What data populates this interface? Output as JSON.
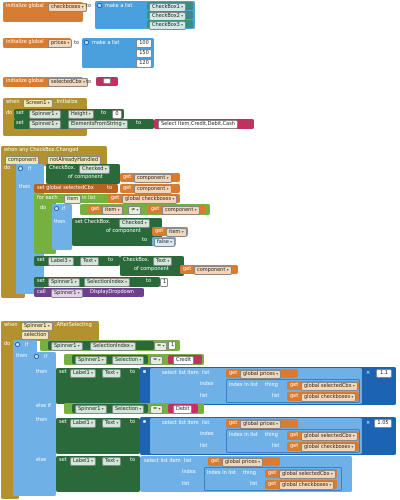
{
  "globals": {
    "checkboxes": {
      "kw": "initialize global",
      "name": "checkboxes",
      "to": "to",
      "make": "make a list",
      "items": [
        "CheckBox1",
        "CheckBox2",
        "CheckBox3"
      ]
    },
    "prices": {
      "kw": "initialize global",
      "name": "prices",
      "to": "to",
      "make": "make a list",
      "items": [
        "100",
        "150",
        "120"
      ]
    },
    "selected": {
      "kw": "initialize global",
      "name": "selectedCbx",
      "to": "to",
      "value": " "
    }
  },
  "init_block": {
    "when": "when",
    "component": "Screen1",
    "event": ".Initialize",
    "do": "do",
    "row1": {
      "set": "set",
      "comp": "Spinner1",
      "prop": "Height",
      "to": "to",
      "value": "0"
    },
    "row2": {
      "set": "set",
      "comp": "Spinner1",
      "prop": "ElementsFromString",
      "to": "to",
      "value": "Select Item,Credit,Debit,Cash"
    }
  },
  "changed_block": {
    "header": "when any CheckBox.Changed",
    "param1": "component",
    "param2": "notAlreadyHandled",
    "do": "do",
    "if": "if",
    "then": "then",
    "cb_label": "CheckBox.",
    "checked": "Checked",
    "of_component": "of component",
    "get": "get",
    "component": "component",
    "set_global": "set global selectedCbx",
    "to": "to",
    "for_each": "for each",
    "item": "item",
    "in_list": "in list",
    "global_checkboxes": "global checkboxes",
    "not_eq": "≠",
    "set_cb": "set CheckBox.",
    "false": "false",
    "set": "set",
    "label3": "Label3",
    "text": "Text",
    "cb_text": "CheckBox.",
    "text_prop": "Text",
    "spinner": "Spinner1",
    "sel_index": "SelectionIndex",
    "one": "1",
    "call": "call",
    "display": "DisplayDropdown"
  },
  "after_block": {
    "when": "when",
    "component": "Spinner1",
    "event": ".AfterSelecting",
    "param": "selection",
    "do": "do",
    "if": "if",
    "then": "then",
    "else_if": "else if",
    "else": "else",
    "spinner": "Spinner1",
    "sel_index": "SelectionIndex",
    "selection": "Selection",
    "eq": "=",
    "one": "1",
    "credit": "Credit",
    "debit": "Debit",
    "set": "set",
    "label1": "Label1",
    "text": "Text",
    "to": "to",
    "mult": "×",
    "select_list_item": "select list item",
    "list": "list",
    "index": "index",
    "index_in_list": "index in list",
    "thing": "thing",
    "get": "get",
    "global_prices": "global prices",
    "global_selected": "global selectedCbx",
    "global_checkboxes": "global checkboxes",
    "factor1": "1.1",
    "factor2": "1.05"
  }
}
